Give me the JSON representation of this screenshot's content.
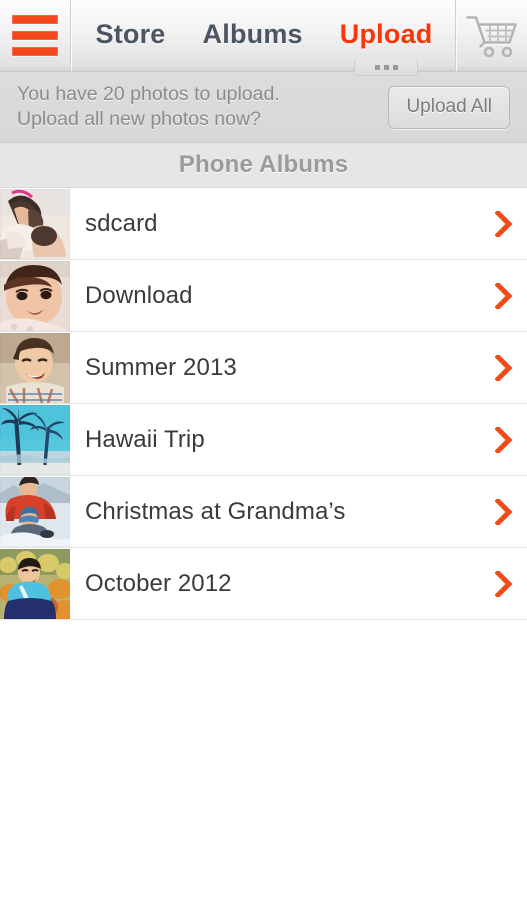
{
  "nav": {
    "menu_icon": "hamburger-menu-icon",
    "cart_icon": "shopping-cart-icon",
    "items": [
      {
        "label": "Store",
        "active": false
      },
      {
        "label": "Albums",
        "active": false
      },
      {
        "label": "Upload",
        "active": true
      }
    ],
    "active_tab_handle_dots": 3,
    "accent_color": "#f8360a",
    "text_color": "#4b5662"
  },
  "notice": {
    "line1": "You have 20 photos to upload.",
    "line2": "Upload all new photos now?",
    "photo_count": 20,
    "button_label": "Upload All"
  },
  "section": {
    "title": "Phone Albums"
  },
  "albums": [
    {
      "name": "sdcard",
      "thumb": "girl-kissing-baby-photo",
      "chevron_icon": "chevron-right-icon"
    },
    {
      "name": "Download",
      "thumb": "smiling-baby-photo",
      "chevron_icon": "chevron-right-icon"
    },
    {
      "name": "Summer 2013",
      "thumb": "boy-on-beach-photo",
      "chevron_icon": "chevron-right-icon"
    },
    {
      "name": "Hawaii Trip",
      "thumb": "palm-trees-photo",
      "chevron_icon": "chevron-right-icon"
    },
    {
      "name": "Christmas at Grandma’s",
      "thumb": "father-son-in-snow-photo",
      "chevron_icon": "chevron-right-icon"
    },
    {
      "name": "October 2012",
      "thumb": "boy-with-pumpkins-photo",
      "chevron_icon": "chevron-right-icon"
    }
  ],
  "colors": {
    "accent_orange": "#f4471e",
    "chevron_orange": "#ef4a17",
    "nav_text": "#4b5662",
    "notice_bg": "#dcdcdc",
    "notice_text": "#8c8c8c",
    "section_bg": "#e6e6e6",
    "section_text": "#9b9b9b",
    "album_text": "#3b3b3b",
    "page_bg": "#ffffff"
  }
}
